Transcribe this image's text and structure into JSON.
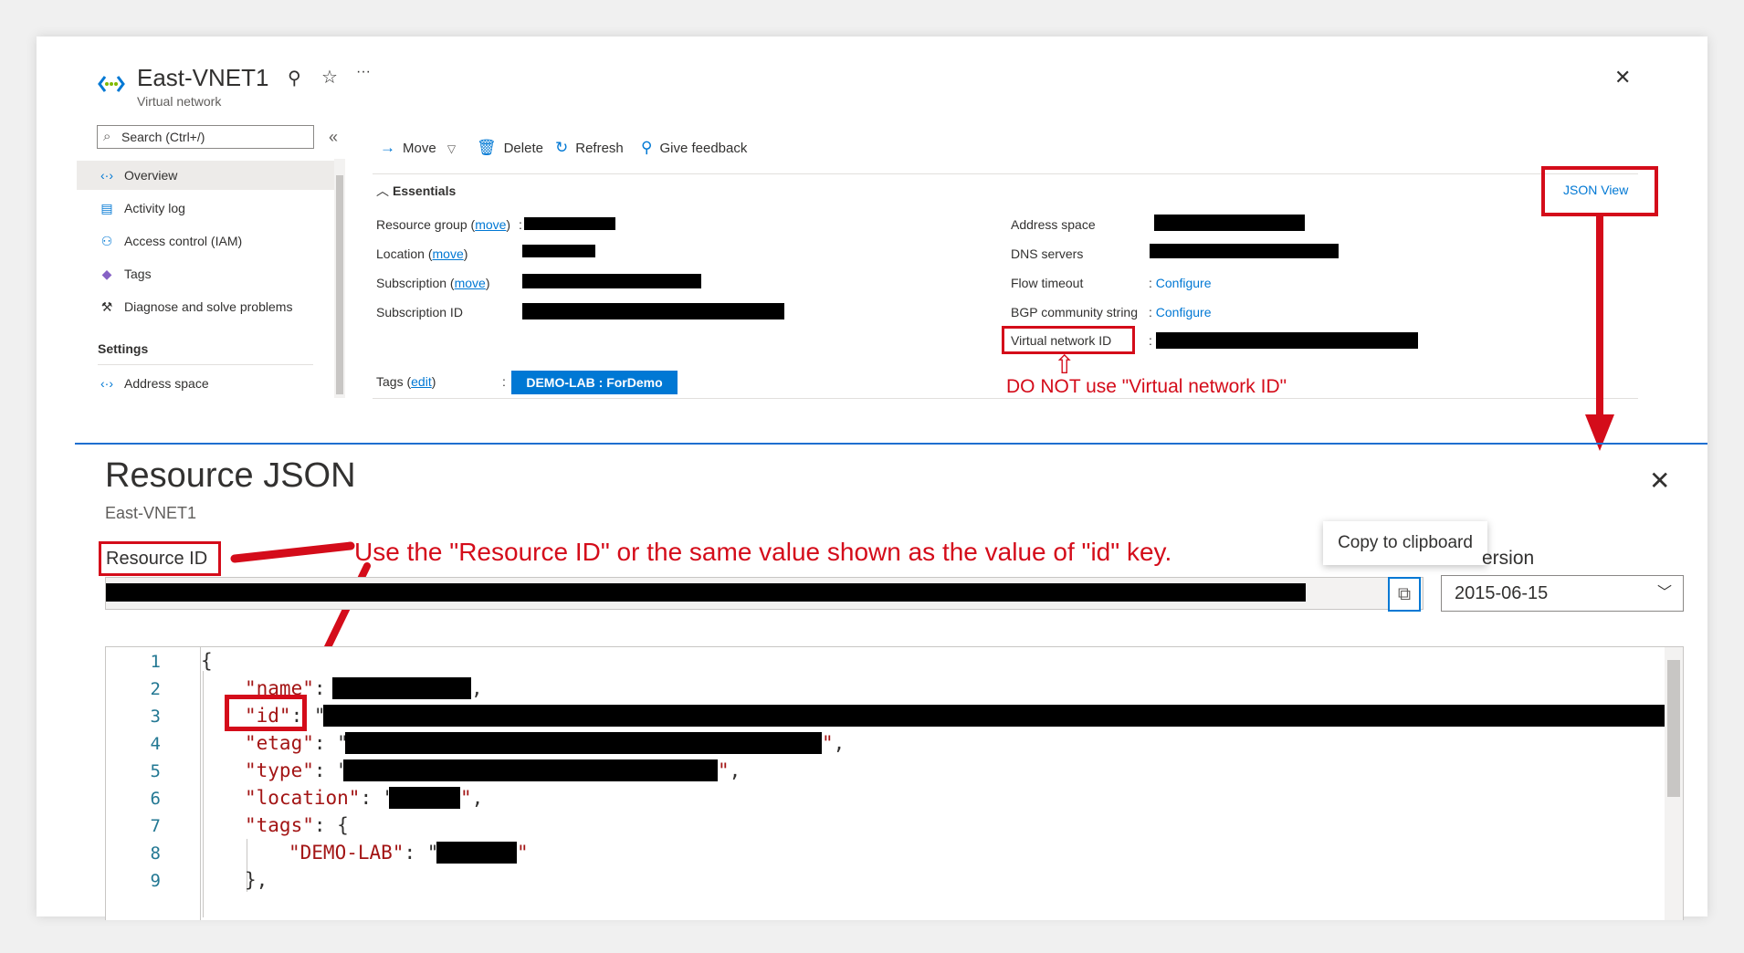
{
  "blade": {
    "title": "East-VNET1",
    "subtitle": "Virtual network",
    "search_placeholder": "Search (Ctrl+/)",
    "collapse_glyph": "«",
    "more_glyph": "···",
    "close_glyph": "✕"
  },
  "nav": {
    "items": [
      {
        "label": "Overview",
        "icon": "vnet-icon"
      },
      {
        "label": "Activity log",
        "icon": "activity-log-icon"
      },
      {
        "label": "Access control (IAM)",
        "icon": "iam-icon"
      },
      {
        "label": "Tags",
        "icon": "tag-icon"
      },
      {
        "label": "Diagnose and solve problems",
        "icon": "wrench-icon"
      }
    ],
    "section_settings": "Settings",
    "settings_items": [
      {
        "label": "Address space",
        "icon": "vnet-icon"
      }
    ]
  },
  "toolbar": {
    "move": "Move",
    "delete": "Delete",
    "refresh": "Refresh",
    "feedback": "Give feedback"
  },
  "essentials": {
    "heading": "Essentials",
    "json_view": "JSON View",
    "resource_group": "Resource group",
    "location": "Location",
    "subscription": "Subscription",
    "subscription_id": "Subscription ID",
    "move_link": "move",
    "tags": "Tags",
    "edit_link": "edit",
    "tag_value": "DEMO-LAB : ForDemo",
    "address_space": "Address space",
    "dns_servers": "DNS servers",
    "flow_timeout": "Flow timeout",
    "bgp_community": "BGP community string",
    "configure": "Configure",
    "virtual_network_id": "Virtual network ID"
  },
  "annotations": {
    "dont_use": "DO NOT use \"Virtual network ID\"",
    "use_rid": "Use the \"Resource ID\" or the same value shown as the value of \"id\" key.",
    "accent": "#d40c1a"
  },
  "json_pane": {
    "title": "Resource JSON",
    "subtitle": "East-VNET1",
    "resource_id_label": "Resource ID",
    "copy_tooltip": "Copy to clipboard",
    "api_version_label": "ersion",
    "api_version_value": "2015-06-15",
    "lines": [
      "1",
      "2",
      "3",
      "4",
      "5",
      "6",
      "7",
      "8",
      "9"
    ],
    "code": {
      "l1": "{",
      "k_name": "\"name\"",
      "k_id": "\"id\"",
      "k_etag": "\"etag\"",
      "k_type": "\"type\"",
      "k_location": "\"location\"",
      "k_tags": "\"tags\"",
      "k_demolab": "\"DEMO-LAB\"",
      "l9": "},"
    }
  }
}
